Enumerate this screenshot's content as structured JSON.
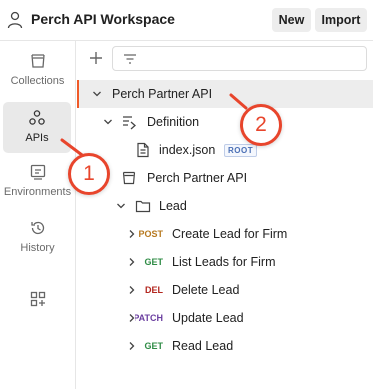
{
  "header": {
    "workspace_title": "Perch API Workspace",
    "new_label": "New",
    "import_label": "Import"
  },
  "sidebar": {
    "items": [
      {
        "label": "Collections",
        "icon": "collections-icon",
        "active": false
      },
      {
        "label": "APIs",
        "icon": "apis-icon",
        "active": true
      },
      {
        "label": "Environments",
        "icon": "environments-icon",
        "active": false
      },
      {
        "label": "History",
        "icon": "history-icon",
        "active": false
      },
      {
        "label": "",
        "icon": "add-workbench-icon",
        "active": false
      }
    ]
  },
  "tree": {
    "api_name": "Perch Partner API",
    "definition_label": "Definition",
    "file_name": "index.json",
    "root_badge": "ROOT",
    "collection_name": "Perch Partner API",
    "folder_name": "Lead",
    "requests": [
      {
        "method": "POST",
        "name": "Create Lead for Firm",
        "color": "#b7791f"
      },
      {
        "method": "GET",
        "name": "List Leads for Firm",
        "color": "#2f8c46"
      },
      {
        "method": "DEL",
        "name": "Delete Lead",
        "color": "#b3261e"
      },
      {
        "method": "PATCH",
        "name": "Update Lead",
        "color": "#6b3fa0"
      },
      {
        "method": "GET",
        "name": "Read Lead",
        "color": "#2f8c46"
      }
    ]
  },
  "callouts": {
    "first": "1",
    "second": "2"
  },
  "colors": {
    "accent": "#f05a28",
    "callout": "#e8452c"
  }
}
